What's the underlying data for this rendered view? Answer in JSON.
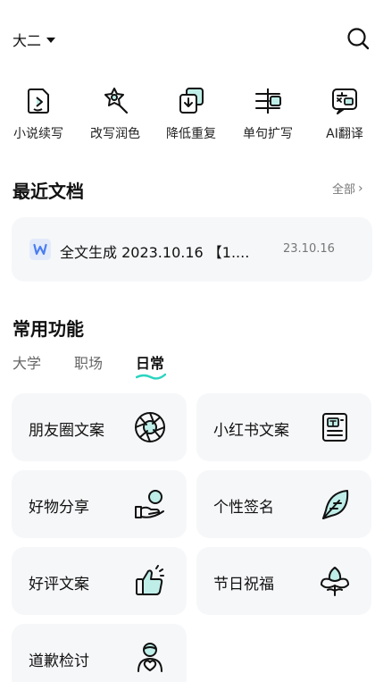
{
  "header": {
    "grade_label": "大二"
  },
  "tools": [
    {
      "label": "小说续写",
      "icon": "novel-continue-icon"
    },
    {
      "label": "改写润色",
      "icon": "rewrite-polish-icon"
    },
    {
      "label": "降低重复",
      "icon": "reduce-duplicate-icon"
    },
    {
      "label": "单句扩写",
      "icon": "sentence-expand-icon"
    },
    {
      "label": "AI翻译",
      "icon": "ai-translate-icon"
    }
  ],
  "recent": {
    "title": "最近文档",
    "all_label": "全部",
    "doc": {
      "title": "全文生成 2023.10.16 【1....",
      "date": "23.10.16",
      "icon": "word-doc-icon"
    }
  },
  "features": {
    "title": "常用功能",
    "tabs": [
      "大学",
      "职场",
      "日常"
    ],
    "active_tab": "日常",
    "items": [
      {
        "label": "朋友圈文案",
        "icon": "camera-aperture-icon"
      },
      {
        "label": "小红书文案",
        "icon": "notebook-icon"
      },
      {
        "label": "好物分享",
        "icon": "hand-gift-icon"
      },
      {
        "label": "个性签名",
        "icon": "feather-pen-icon"
      },
      {
        "label": "好评文案",
        "icon": "thumbs-up-icon"
      },
      {
        "label": "节日祝福",
        "icon": "flower-icon"
      },
      {
        "label": "道歉检讨",
        "icon": "apology-person-icon"
      }
    ]
  },
  "colors": {
    "accent": "#2bd4c0",
    "card_bg": "#f6f7f9",
    "icon_fill": "#bfeee8"
  }
}
